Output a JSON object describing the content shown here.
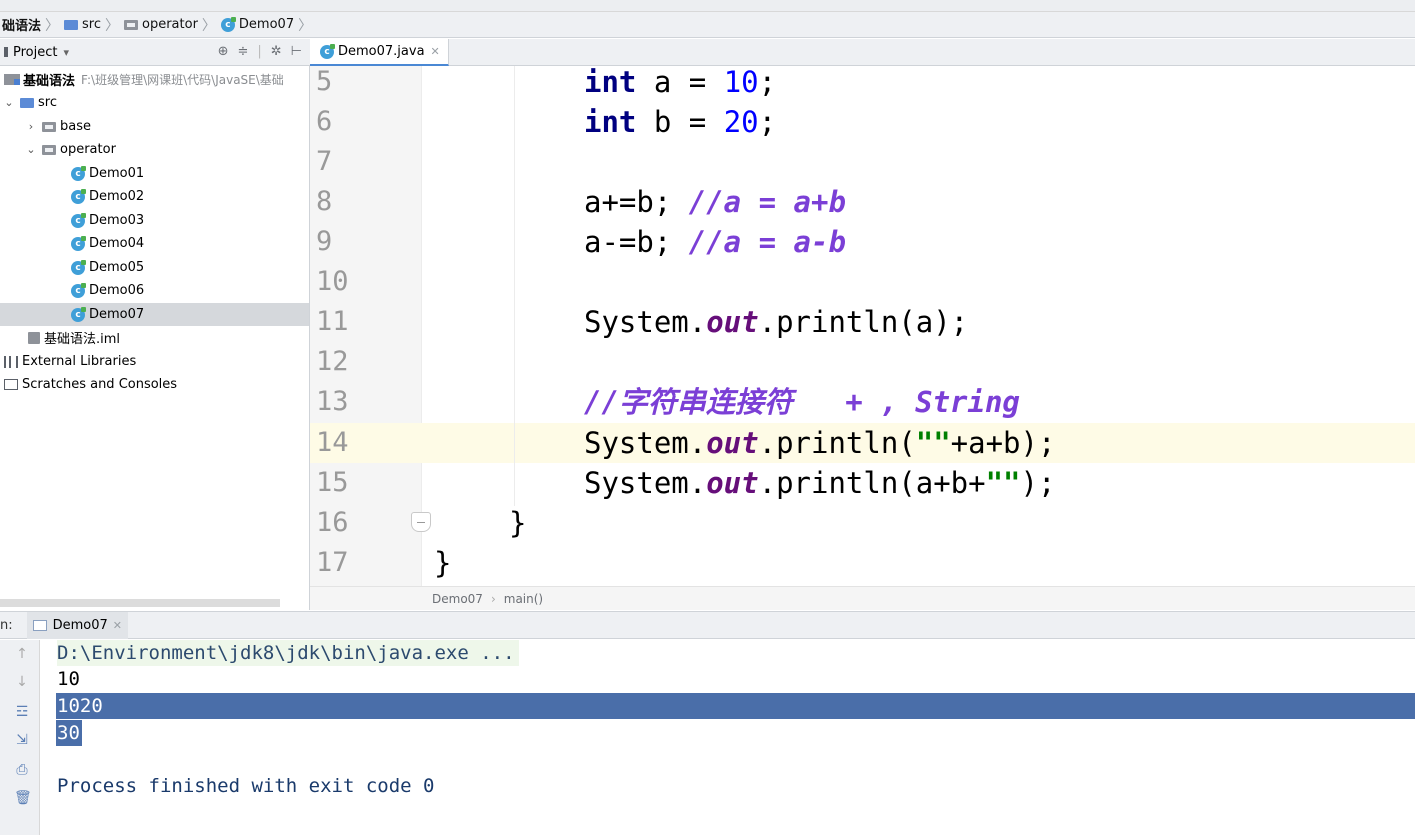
{
  "breadcrumb": {
    "items": [
      {
        "label": "础语法",
        "icon": "project-icon"
      },
      {
        "label": "src",
        "icon": "folder-blue-icon"
      },
      {
        "label": "operator",
        "icon": "folder-icon"
      },
      {
        "label": "Demo07",
        "icon": "class-icon"
      }
    ]
  },
  "project": {
    "title": "Project",
    "dropdown": "▾",
    "root": {
      "name": "基础语法",
      "path": "F:\\班级管理\\网课班\\代码\\JavaSE\\基础"
    },
    "src": "src",
    "base": "base",
    "operator": "operator",
    "classes": [
      "Demo01",
      "Demo02",
      "Demo03",
      "Demo04",
      "Demo05",
      "Demo06",
      "Demo07"
    ],
    "selected": "Demo07",
    "iml": "基础语法.iml",
    "external_libraries": "External Libraries",
    "scratches": "Scratches and Consoles"
  },
  "editor": {
    "tab_label": "Demo07.java",
    "line_numbers": [
      "5",
      "6",
      "7",
      "8",
      "9",
      "10",
      "11",
      "12",
      "13",
      "14",
      "15",
      "16",
      "17"
    ],
    "current_line": "14",
    "code": {
      "l5": {
        "kw": "int",
        "rest": " a = ",
        "num": "10",
        "end": ";"
      },
      "l6": {
        "kw": "int",
        "rest": " b = ",
        "num": "20",
        "end": ";"
      },
      "l8": {
        "code": "a+=b; ",
        "comment": "//a = a+b"
      },
      "l9": {
        "code": "a-=b; ",
        "comment": "//a = a-b"
      },
      "l11": {
        "pre": "System.",
        "field": "out",
        "post": ".println(a);"
      },
      "l13": {
        "comment": "//字符串连接符   + , String"
      },
      "l14": {
        "pre": "System.",
        "field": "out",
        "mid": ".println(",
        "str": "\"\"",
        "post": "+a+b);"
      },
      "l15": {
        "pre": "System.",
        "field": "out",
        "mid": ".println(a+b+",
        "str": "\"\"",
        "post": ");"
      },
      "l16": "}",
      "l17": "}"
    },
    "breadcrumb": [
      "Demo07",
      "main()"
    ]
  },
  "run": {
    "label": "n:",
    "tab_label": "Demo07",
    "output": {
      "command": "D:\\Environment\\jdk8\\jdk\\bin\\java.exe ...",
      "line1": "10",
      "line2": "1020",
      "line3": "30",
      "finished": "Process finished with exit code 0"
    }
  },
  "colors": {
    "keyword": "#000080",
    "number": "#0000ff",
    "comment": "#7b3fd6",
    "field": "#660e7a",
    "string": "#008000",
    "selection": "#4a6ea9",
    "current_line": "#fefbe6"
  }
}
